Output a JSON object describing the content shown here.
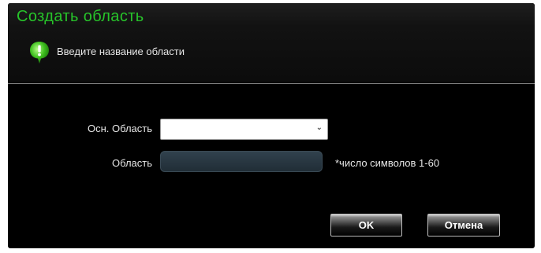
{
  "dialog": {
    "title": "Создать область",
    "hint_icon": "green-info-bubble-icon",
    "hint": "Введите название области",
    "accent_color": "#27c42a"
  },
  "form": {
    "parent_label": "Осн. Область",
    "parent_value": "",
    "area_label": "Область",
    "area_value": "",
    "area_note": "*число символов 1-60"
  },
  "buttons": {
    "ok": "OK",
    "cancel": "Отмена"
  }
}
